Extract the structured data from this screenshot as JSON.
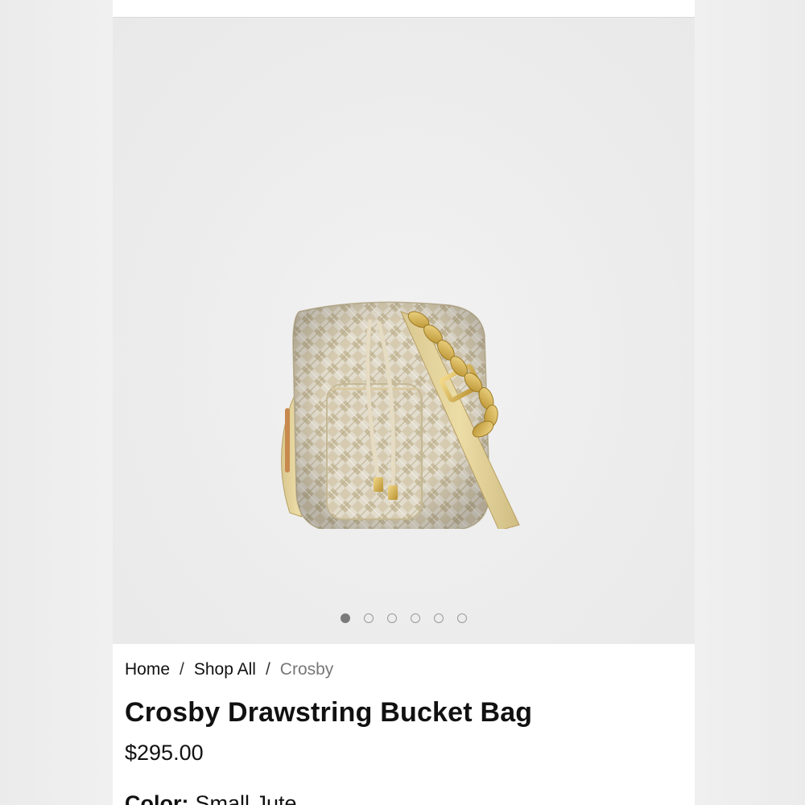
{
  "breadcrumb": {
    "home": "Home",
    "separator": "/",
    "shop_all": "Shop All",
    "current": "Crosby"
  },
  "product": {
    "title": "Crosby Drawstring Bucket Bag",
    "price": "$295.00",
    "color_label": "Color:",
    "color_value": "Small Jute"
  },
  "gallery": {
    "image_alt": "Crosby Drawstring Bucket Bag in Small Jute",
    "slide_count": 6,
    "active_slide": 1
  }
}
